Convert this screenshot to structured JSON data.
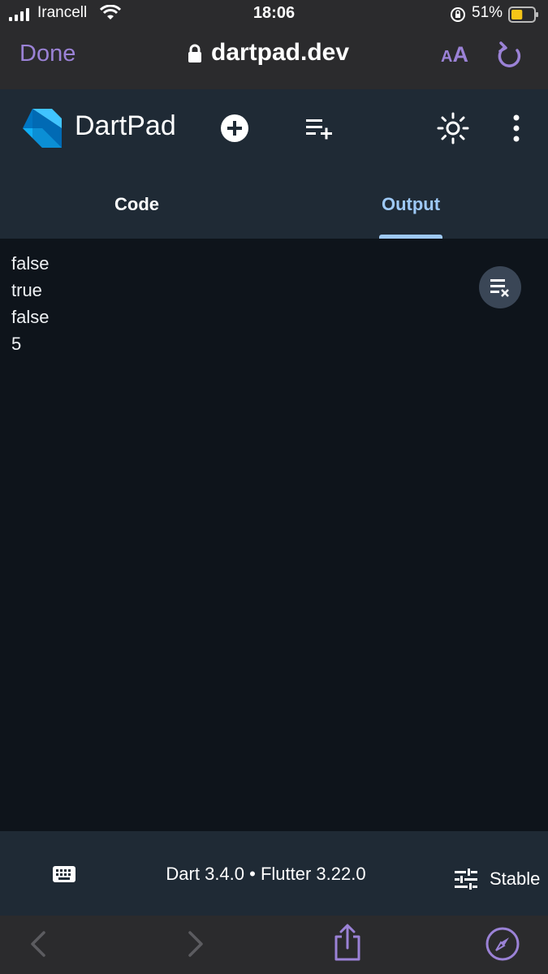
{
  "status_bar": {
    "carrier": "Irancell",
    "time": "18:06",
    "battery_percent": "51%",
    "battery_level": 0.51
  },
  "browser": {
    "done_label": "Done",
    "url": "dartpad.dev",
    "text_size_label_small": "A",
    "text_size_label_big": "A"
  },
  "header": {
    "title": "DartPad",
    "icons": [
      "dart-logo",
      "new-pad",
      "install-package",
      "theme",
      "more"
    ]
  },
  "tabs": [
    {
      "label": "Code",
      "active": false
    },
    {
      "label": "Output",
      "active": true
    }
  ],
  "output": {
    "lines": [
      "false",
      "true",
      "false",
      "5"
    ]
  },
  "footer": {
    "versions": "Dart 3.4.0 • Flutter 3.22.0",
    "channel": "Stable"
  },
  "colors": {
    "accent_safari": "#9b82d6",
    "tab_active": "#9ec9f7",
    "header_bg": "#1f2a35",
    "output_bg": "#0e141b"
  }
}
